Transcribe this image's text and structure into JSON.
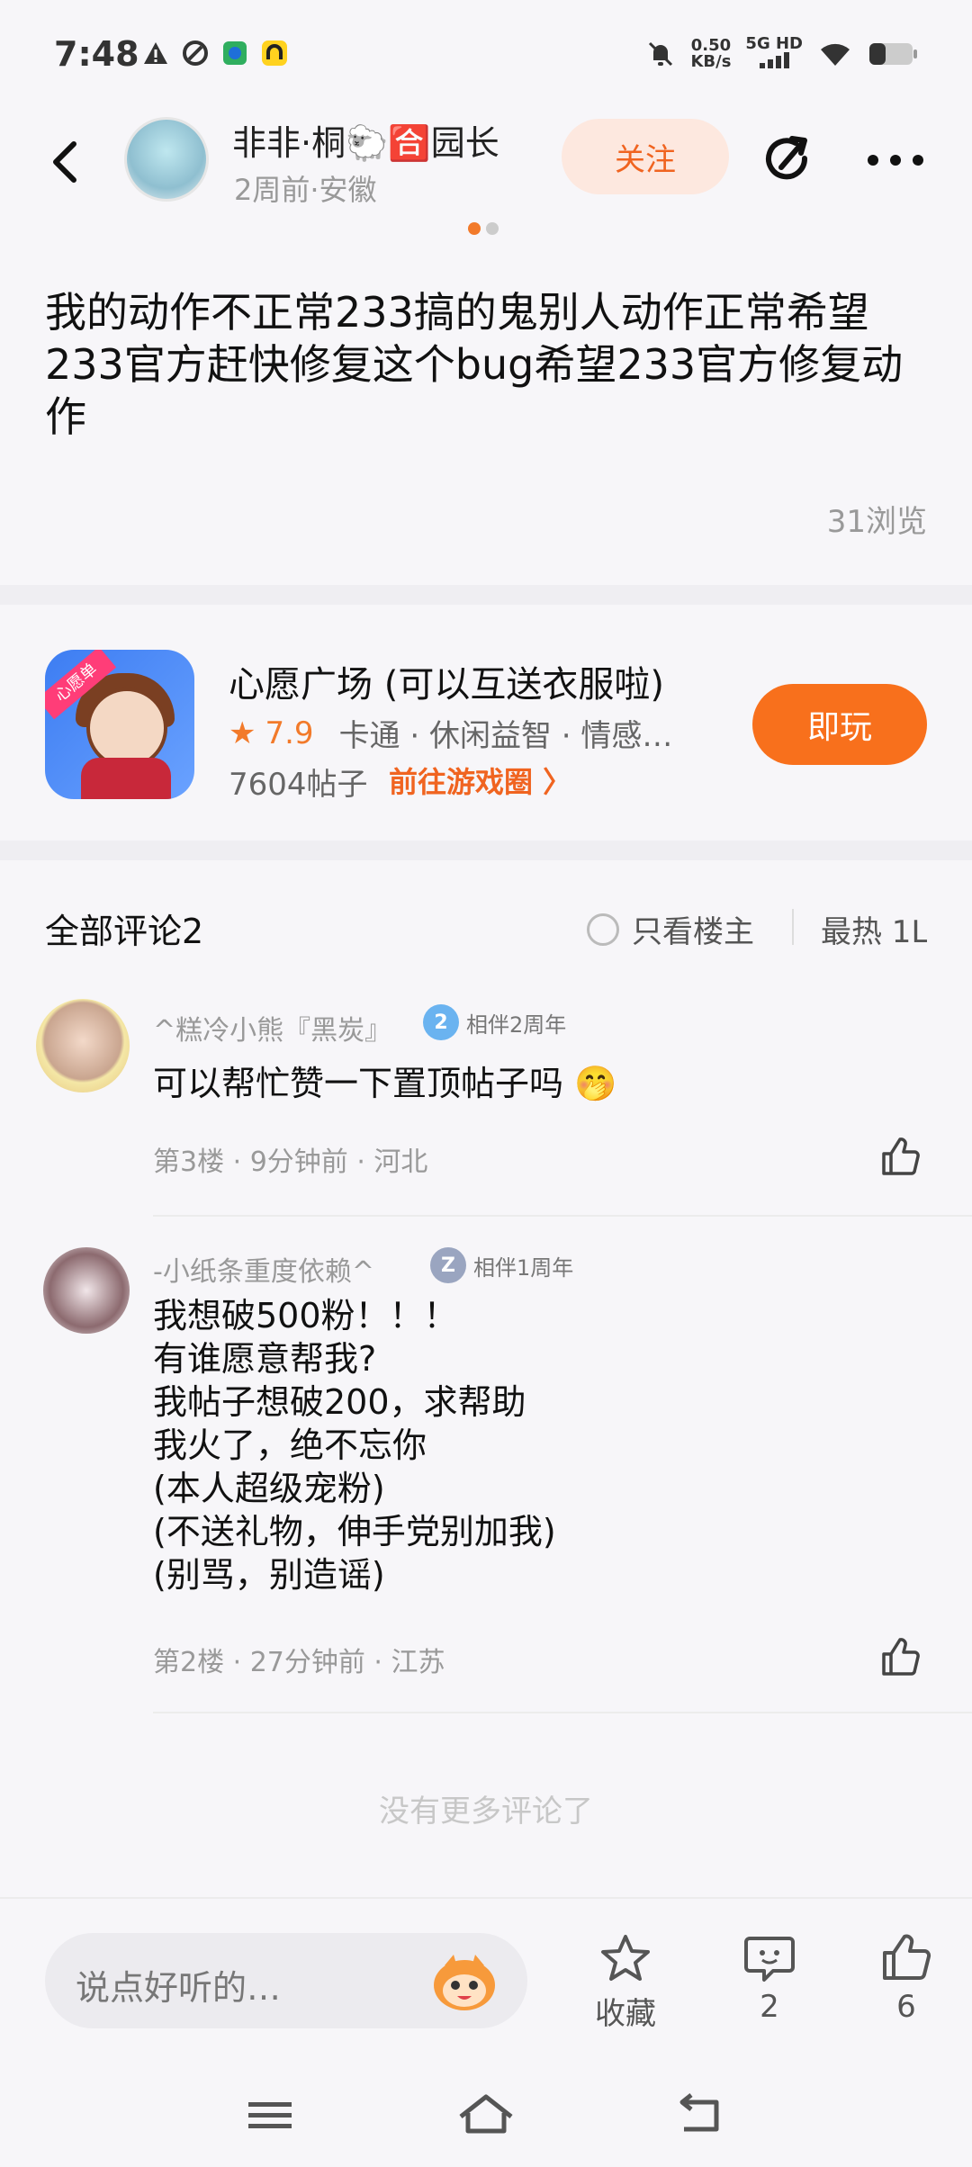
{
  "status": {
    "time": "7:48",
    "speed_value": "0.50",
    "speed_unit": "KB/s",
    "network": "5G HD"
  },
  "header": {
    "username": "非非·桐🐑🈴园长",
    "meta": "2周前·安徽",
    "follow_label": "关注"
  },
  "post": {
    "text": "我的动作不正常233搞的鬼别人动作正常希望233官方赶快修复这个bug希望233官方修复动作",
    "views": "31浏览"
  },
  "game": {
    "icon_text": "心愿单",
    "title": "心愿广场 (可以互送衣服啦)",
    "rating": "7.9",
    "tags": "卡通 · 休闲益智 · 情感…",
    "posts": "7604帖子",
    "link": "前往游戏圈 〉",
    "play_label": "即玩",
    "accent": "#f8701c"
  },
  "comments_header": {
    "title": "全部评论2",
    "only_host": "只看楼主",
    "sort": "最热 1L"
  },
  "comments": [
    {
      "name": "^糕冷小熊『黑炭』",
      "badge_num": "2",
      "badge": "相伴2周年",
      "text": "可以帮忙赞一下置顶帖子吗 🤭",
      "meta": "第3楼 · 9分钟前 · 河北"
    },
    {
      "name": "-小纸条重度依赖^",
      "badge_num": "Z",
      "badge": "相伴1周年",
      "text": "我想破500粉！！！\n有谁愿意帮我?\n我帖子想破200，求帮助\n我火了，绝不忘你\n(本人超级宠粉)\n(不送礼物，伸手党别加我)\n(别骂，别造谣)",
      "meta": "第2楼 · 27分钟前 · 江苏"
    }
  ],
  "no_more": "没有更多评论了",
  "bottom": {
    "placeholder": "说点好听的…",
    "collect_label": "收藏",
    "comment_count": "2",
    "like_count": "6"
  }
}
